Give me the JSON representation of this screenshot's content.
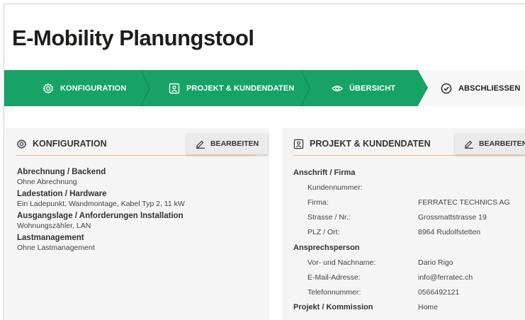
{
  "page": {
    "title": "E-Mobility Planungstool"
  },
  "colors": {
    "accent_green": "#16a365",
    "rule_orange": "#e8b88e",
    "panel_bg": "#f5f5f5"
  },
  "stepper": {
    "steps": [
      {
        "label": "Konfiguration",
        "icon": "gear-icon",
        "state": "done"
      },
      {
        "label": "Projekt & Kundendaten",
        "icon": "contact-card-icon",
        "state": "done"
      },
      {
        "label": "Übersicht",
        "icon": "eye-icon",
        "state": "done"
      },
      {
        "label": "Abschliessen",
        "icon": "check-circle-icon",
        "state": "current"
      }
    ]
  },
  "config_panel": {
    "title": "Konfiguration",
    "icon": "gear-icon",
    "edit_label": "Bearbeiten",
    "items": [
      {
        "title": "Abrechnung / Backend",
        "value": "Ohne Abrechnung"
      },
      {
        "title": "Ladestation / Hardware",
        "value": "Ein Ladepunkt, Wandmontage, Kabel Typ 2, 11 kW"
      },
      {
        "title": "Ausgangslage / Anforderungen Installation",
        "value": "Wohnungszähler, LAN"
      },
      {
        "title": "Lastmanagement",
        "value": "Ohne Lastmanagement"
      }
    ]
  },
  "project_panel": {
    "title": "Projekt & Kundendaten",
    "icon": "contact-card-icon",
    "edit_label": "Bearbeiten",
    "sections": {
      "address": {
        "heading": "Anschrift / Firma",
        "rows": [
          {
            "label": "Kundennummer:",
            "value": ""
          },
          {
            "label": "Firma:",
            "value": "FERRATEC TECHNICS AG"
          },
          {
            "label": "Strasse / Nr.:",
            "value": "Grossmattstrasse 19"
          },
          {
            "label": "PLZ / Ort:",
            "value": "8964 Rudolfstetten"
          }
        ]
      },
      "contact": {
        "heading": "Ansprechsperson",
        "rows": [
          {
            "label": "Vor- und Nachname:",
            "value": "Dario Rigo"
          },
          {
            "label": "E-Mail-Adresse:",
            "value": "info@ferratec.ch"
          },
          {
            "label": "Telefonnummer:",
            "value": "0566492121"
          }
        ]
      },
      "project": {
        "heading": "Projekt / Kommission",
        "value": "Home"
      }
    }
  }
}
